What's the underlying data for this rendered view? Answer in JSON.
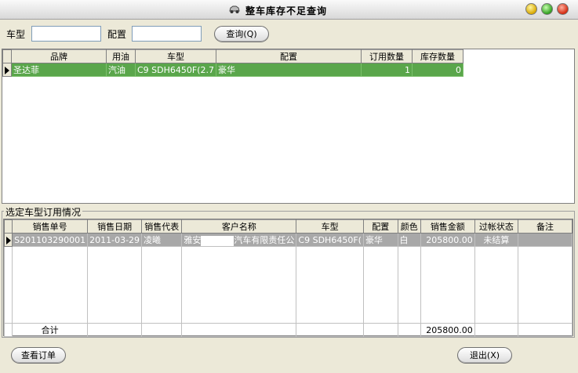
{
  "window": {
    "title": "整车库存不足查询"
  },
  "filter": {
    "model_label": "车型",
    "model_value": "",
    "config_label": "配置",
    "config_value": "",
    "query_button": "查询(Q)"
  },
  "stock_grid": {
    "columns": [
      "品牌",
      "用油",
      "车型",
      "配置",
      "订用数量",
      "库存数量"
    ],
    "rows": [
      {
        "brand": "圣达菲",
        "fuel": "汽油",
        "model": "C9 SDH6450F(2.7",
        "config": "豪华",
        "ordered_qty": "1",
        "stock_qty": "0"
      }
    ]
  },
  "orders_section": {
    "title": "选定车型订用情况",
    "columns": [
      "销售单号",
      "销售日期",
      "销售代表",
      "客户名称",
      "车型",
      "配置",
      "颜色",
      "销售金额",
      "过帐状态",
      "备注"
    ],
    "rows": [
      {
        "order_no": "S201103290001",
        "date": "2011-03-29",
        "rep": "凌曦",
        "customer_prefix": "雅安",
        "customer_suffix": "汽车有限责任公",
        "model": "C9 SDH6450F(",
        "config": "豪华",
        "color": "白",
        "amount": "205800.00",
        "status": "未结算",
        "note": ""
      }
    ],
    "total_label": "合计",
    "total_amount": "205800.00"
  },
  "footer": {
    "view_order_button": "查看订单",
    "exit_button": "退出(X)"
  }
}
